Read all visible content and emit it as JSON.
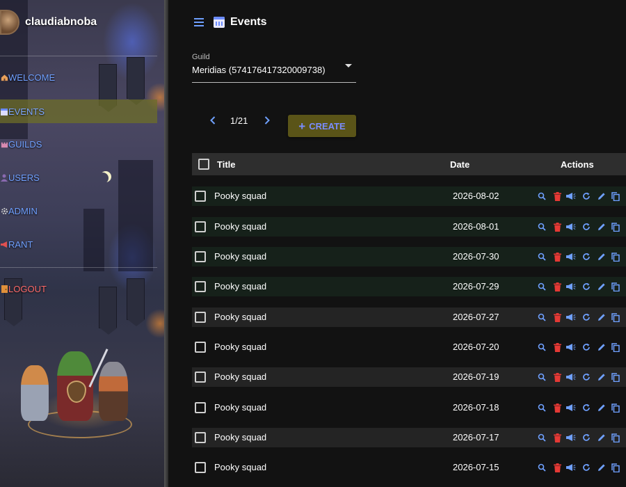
{
  "app": {
    "username": "claudiabnoba"
  },
  "sidebar": {
    "items": [
      {
        "label": "WELCOME",
        "icon": "home-icon",
        "active": false
      },
      {
        "label": "EVENTS",
        "icon": "calendar-icon",
        "active": true
      },
      {
        "label": "GUILDS",
        "icon": "castle-icon",
        "active": false
      },
      {
        "label": "USERS",
        "icon": "users-icon",
        "active": false
      },
      {
        "label": "ADMIN",
        "icon": "gear-icon",
        "active": false
      },
      {
        "label": "RANT",
        "icon": "megaphone-icon",
        "active": false
      },
      {
        "label": "LOGOUT",
        "icon": "door-icon",
        "active": false
      }
    ]
  },
  "header": {
    "title": "Events",
    "menu_icon": "hamburger-icon",
    "page_icon": "calendar-icon"
  },
  "guild_select": {
    "label": "Guild",
    "value": "Meridias (574176417320009738)"
  },
  "pagination": {
    "text": "1/21",
    "prev_icon": "chevron-left-icon",
    "next_icon": "chevron-right-icon"
  },
  "create_button": {
    "label": "CREATE",
    "icon": "plus-icon"
  },
  "table": {
    "columns": {
      "title": "Title",
      "date": "Date",
      "actions": "Actions"
    },
    "action_icons": [
      "search-icon",
      "trash-icon",
      "megaphone-icon",
      "refresh-icon",
      "pencil-icon",
      "copy-icon"
    ],
    "rows": [
      {
        "title": "Pooky squad",
        "date": "2026-08-02",
        "style": "green"
      },
      {
        "title": "Pooky squad",
        "date": "2026-08-01",
        "style": "green"
      },
      {
        "title": "Pooky squad",
        "date": "2026-07-30",
        "style": "green"
      },
      {
        "title": "Pooky squad",
        "date": "2026-07-29",
        "style": "green"
      },
      {
        "title": "Pooky squad",
        "date": "2026-07-27",
        "style": "gray"
      },
      {
        "title": "Pooky squad",
        "date": "2026-07-20",
        "style": "none"
      },
      {
        "title": "Pooky squad",
        "date": "2026-07-19",
        "style": "gray"
      },
      {
        "title": "Pooky squad",
        "date": "2026-07-18",
        "style": "none"
      },
      {
        "title": "Pooky squad",
        "date": "2026-07-17",
        "style": "gray"
      },
      {
        "title": "Pooky squad",
        "date": "2026-07-15",
        "style": "none"
      }
    ]
  },
  "colors": {
    "accent_blue": "#6fa0ff",
    "danger_red": "#e53935",
    "active_nav": "#6e6e28",
    "create_bg": "#5a5418"
  }
}
